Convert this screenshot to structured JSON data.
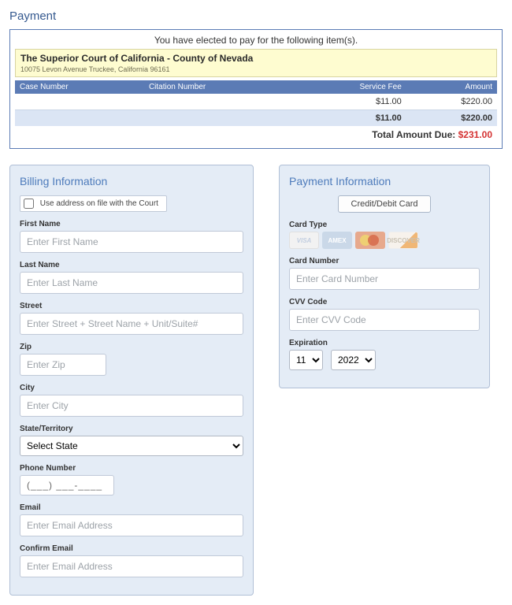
{
  "page_title": "Payment",
  "summary": {
    "elected_text": "You have elected to pay for the following item(s).",
    "court_name": "The Superior Court of California - County of Nevada",
    "court_address": "10075 Levon Avenue Truckee, California 96161",
    "cols": {
      "case": "Case Number",
      "citation": "Citation Number",
      "fee": "Service Fee",
      "amount": "Amount"
    },
    "row": {
      "case": "",
      "citation": "",
      "fee": "$11.00",
      "amount": "$220.00"
    },
    "totals": {
      "fee": "$11.00",
      "amount": "$220.00"
    },
    "grand_label": "Total Amount Due: ",
    "grand_value": "$231.00"
  },
  "billing": {
    "title": "Billing Information",
    "use_address_label": "Use address on file with the Court",
    "first_name": {
      "label": "First Name",
      "ph": "Enter First Name"
    },
    "last_name": {
      "label": "Last Name",
      "ph": "Enter Last Name"
    },
    "street": {
      "label": "Street",
      "ph": "Enter Street + Street Name + Unit/Suite#"
    },
    "zip": {
      "label": "Zip",
      "ph": "Enter Zip"
    },
    "city": {
      "label": "City",
      "ph": "Enter City"
    },
    "state": {
      "label": "State/Territory",
      "selected": "Select State"
    },
    "phone": {
      "label": "Phone Number",
      "mask": "(___) ___-____"
    },
    "email": {
      "label": "Email",
      "ph": "Enter Email Address"
    },
    "confirm": {
      "label": "Confirm Email",
      "ph": "Enter Email Address"
    }
  },
  "payment": {
    "title": "Payment Information",
    "tab": "Credit/Debit Card",
    "card_type_label": "Card Type",
    "card_number": {
      "label": "Card Number",
      "ph": "Enter Card Number"
    },
    "cvv": {
      "label": "CVV Code",
      "ph": "Enter CVV Code"
    },
    "expiration": {
      "label": "Expiration",
      "month": "11",
      "year": "2022"
    }
  }
}
